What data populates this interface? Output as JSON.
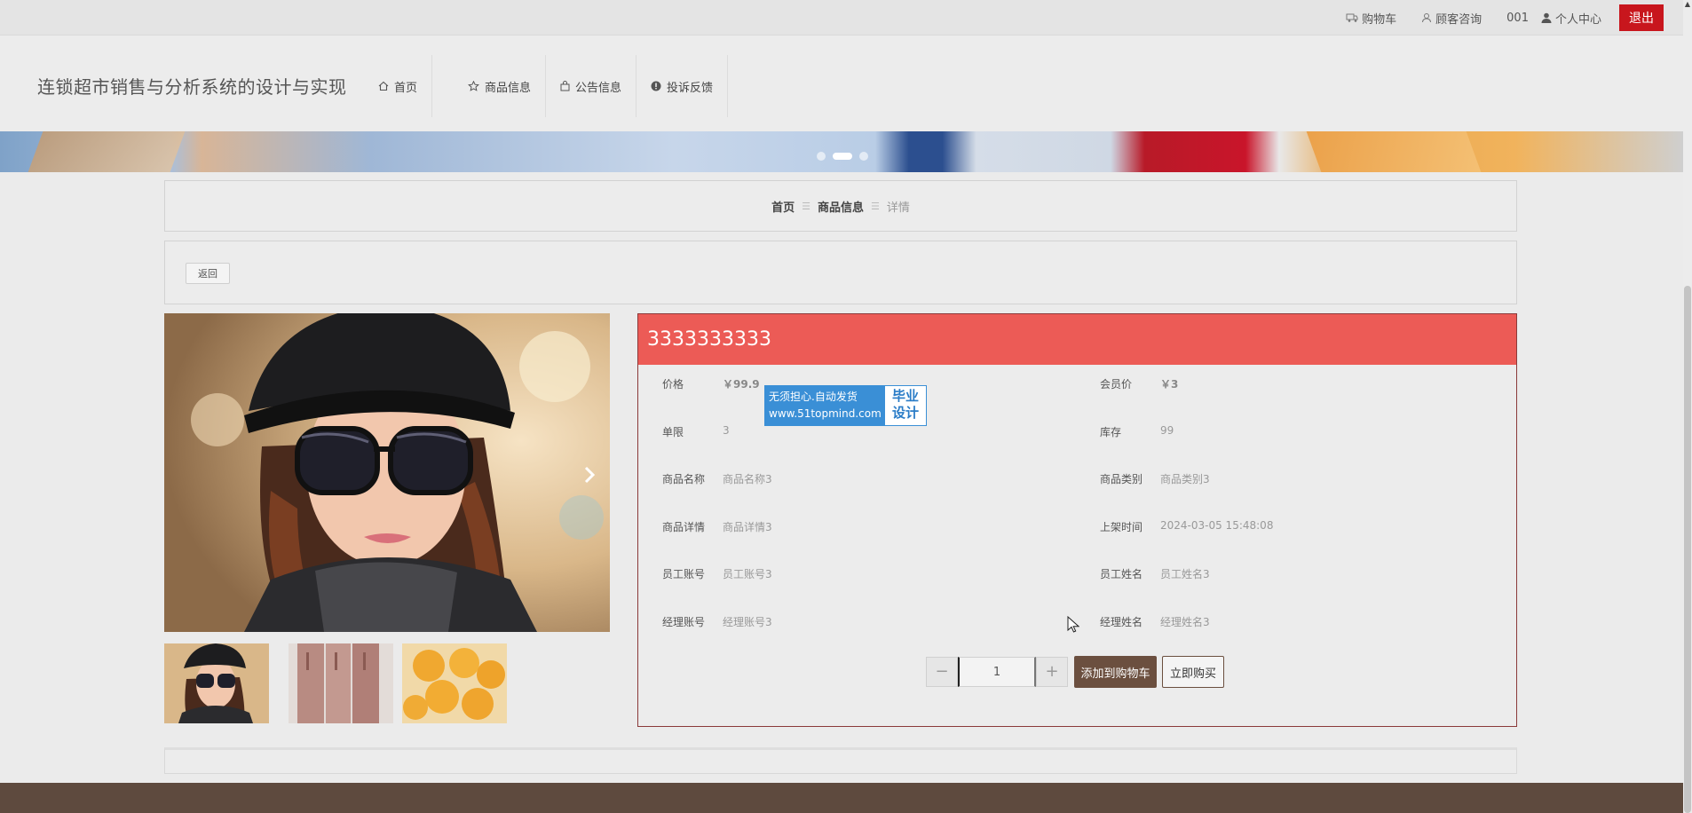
{
  "topbar": {
    "cart": "购物车",
    "consult": "顾客咨询",
    "user_id": "001",
    "profile": "个人中心",
    "logout": "退出"
  },
  "header": {
    "site_title": "连锁超市销售与分析系统的设计与实现",
    "nav": [
      {
        "label": "首页",
        "icon": "home-icon"
      },
      {
        "label": "商品信息",
        "icon": "star-icon"
      },
      {
        "label": "公告信息",
        "icon": "bag-icon"
      },
      {
        "label": "投诉反馈",
        "icon": "alert-icon"
      }
    ]
  },
  "breadcrumb": {
    "home": "首页",
    "category": "商品信息",
    "current": "详情"
  },
  "back_label": "返回",
  "product": {
    "title": "3333333333",
    "fields": {
      "price_label": "价格",
      "price": "￥99.9",
      "member_price_label": "会员价",
      "member_price": "￥3",
      "limit_label": "单限",
      "limit": "3",
      "stock_label": "库存",
      "stock": "99",
      "name_label": "商品名称",
      "name": "商品名称3",
      "category_label": "商品类别",
      "category": "商品类别3",
      "detail_label": "商品详情",
      "detail": "商品详情3",
      "shelf_time_label": "上架时间",
      "shelf_time": "2024-03-05 15:48:08",
      "staff_account_label": "员工账号",
      "staff_account": "员工账号3",
      "staff_name_label": "员工姓名",
      "staff_name": "员工姓名3",
      "manager_account_label": "经理账号",
      "manager_account": "经理账号3",
      "manager_name_label": "经理姓名",
      "manager_name": "经理姓名3"
    },
    "quantity": "1",
    "minus": "−",
    "plus": "+",
    "add_to_cart": "添加到购物车",
    "buy_now": "立即购买"
  },
  "watermark": {
    "line1": "无须担心.自动发货",
    "line2": "www.51topmind.com",
    "right1": "毕业",
    "right2": "设计"
  },
  "colors": {
    "accent": "#ec5b56",
    "logout": "#c8161d",
    "footer": "#5e4a3e",
    "cart_button": "#6b4f3f"
  }
}
